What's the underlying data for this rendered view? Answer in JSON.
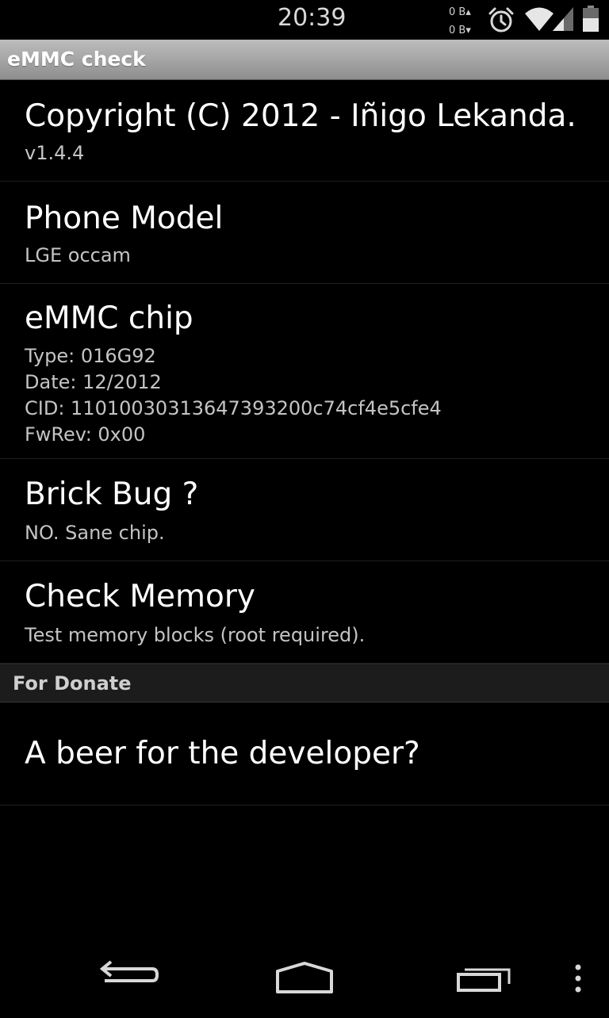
{
  "status_bar": {
    "time": "20:39",
    "upload_rate": "0 B▴",
    "download_rate": "0 B▾",
    "icons": [
      "alarm-icon",
      "wifi-icon",
      "signal-icon",
      "battery-icon"
    ]
  },
  "action_bar": {
    "title": "eMMC check"
  },
  "preferences": {
    "copyright": {
      "title": "Copyright (C) 2012 - Iñigo Lekanda.",
      "summary": "v1.4.4"
    },
    "phone_model": {
      "title": "Phone Model",
      "summary": "LGE occam"
    },
    "emmc_chip": {
      "title": "eMMC chip",
      "lines": [
        "Type: 016G92",
        "Date: 12/2012",
        "CID: 11010030313647393200c74cf4e5cfe4",
        "FwRev: 0x00"
      ]
    },
    "brick_bug": {
      "title": "Brick Bug ?",
      "summary": "NO. Sane chip."
    },
    "check_memory": {
      "title": "Check Memory",
      "summary": "Test memory blocks (root required)."
    }
  },
  "donate": {
    "header": "For Donate",
    "beer": {
      "title": "A beer for the developer?"
    }
  },
  "nav_bar": {
    "icons": [
      "back-icon",
      "home-icon",
      "recents-icon",
      "overflow-menu-icon"
    ]
  },
  "colors": {
    "background": "#000000",
    "action_bar_top": "#bdbdbd",
    "action_bar_bottom": "#8e8e8e",
    "category_bg": "#1c1c1c",
    "summary_text": "#c4c4c4"
  }
}
